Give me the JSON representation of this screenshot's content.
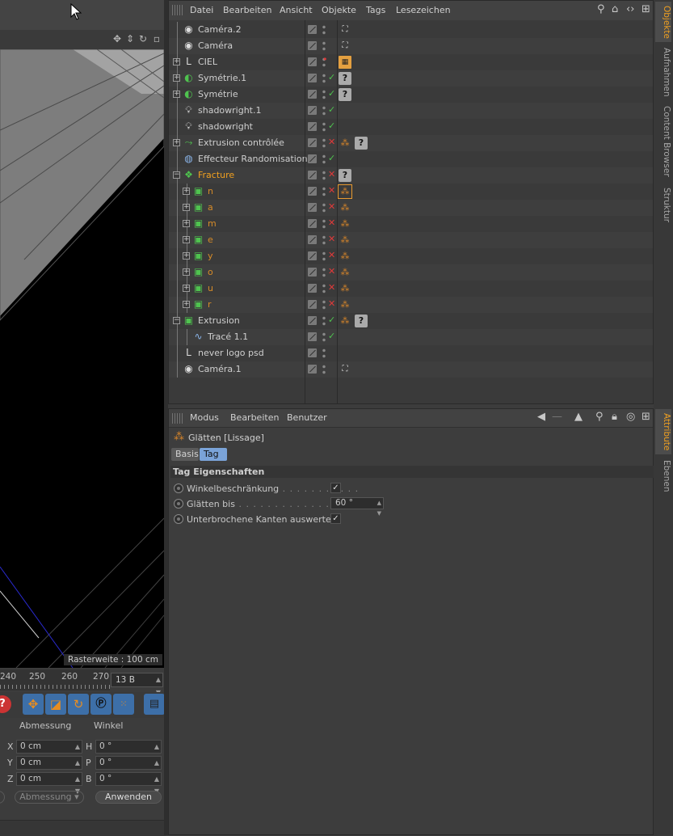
{
  "objects_manager": {
    "menu": [
      "Datei",
      "Bearbeiten",
      "Ansicht",
      "Objekte",
      "Tags",
      "Lesezeichen"
    ],
    "objects": [
      {
        "name": "Caméra.2",
        "icon": "camera-icon",
        "expand": false,
        "indent": 0,
        "enabled": "dot",
        "tags": [
          "camera-target-tag"
        ]
      },
      {
        "name": "Caméra",
        "icon": "camera-icon",
        "expand": false,
        "indent": 0,
        "enabled": "dot",
        "tags": [
          "camera-target-tag"
        ]
      },
      {
        "name": "CIEL",
        "icon": "sky-icon",
        "expand": true,
        "indent": 0,
        "enabled": "red-dot",
        "tags": [
          "film-tag"
        ]
      },
      {
        "name": "Symétrie.1",
        "icon": "symmetry-icon",
        "expand": true,
        "indent": 0,
        "enabled": "check",
        "tags": [
          "unknown-tag"
        ]
      },
      {
        "name": "Symétrie",
        "icon": "symmetry-icon",
        "expand": true,
        "indent": 0,
        "enabled": "check",
        "tags": [
          "unknown-tag"
        ]
      },
      {
        "name": "shadowright.1",
        "icon": "light-icon",
        "expand": false,
        "indent": 0,
        "enabled": "check",
        "tags": []
      },
      {
        "name": "shadowright",
        "icon": "light-icon",
        "expand": false,
        "indent": 0,
        "enabled": "check",
        "tags": []
      },
      {
        "name": "Extrusion contrôlée",
        "icon": "sweep-icon",
        "expand": true,
        "indent": 0,
        "enabled": "cross",
        "tags": [
          "phong-tag",
          "unknown-tag"
        ]
      },
      {
        "name": "Effecteur Randomisation",
        "icon": "effector-icon",
        "expand": false,
        "indent": 0,
        "enabled": "check",
        "tags": []
      },
      {
        "name": "Fracture",
        "icon": "fracture-icon",
        "expand": true,
        "indent": 0,
        "enabled": "cross",
        "tags": [
          "unknown-tag"
        ],
        "highlight": true
      },
      {
        "name": "n",
        "icon": "extrude-icon",
        "expand": true,
        "indent": 1,
        "enabled": "cross",
        "tags": [
          "phong-tag-selected"
        ],
        "orange": true
      },
      {
        "name": "a",
        "icon": "extrude-icon",
        "expand": true,
        "indent": 1,
        "enabled": "cross",
        "tags": [
          "phong-tag"
        ],
        "orange": true
      },
      {
        "name": "m",
        "icon": "extrude-icon",
        "expand": true,
        "indent": 1,
        "enabled": "cross",
        "tags": [
          "phong-tag"
        ],
        "orange": true
      },
      {
        "name": "e",
        "icon": "extrude-icon",
        "expand": true,
        "indent": 1,
        "enabled": "cross",
        "tags": [
          "phong-tag"
        ],
        "orange": true
      },
      {
        "name": "y",
        "icon": "extrude-icon",
        "expand": true,
        "indent": 1,
        "enabled": "cross",
        "tags": [
          "phong-tag"
        ],
        "orange": true
      },
      {
        "name": "o",
        "icon": "extrude-icon",
        "expand": true,
        "indent": 1,
        "enabled": "cross",
        "tags": [
          "phong-tag"
        ],
        "orange": true
      },
      {
        "name": "u",
        "icon": "extrude-icon",
        "expand": true,
        "indent": 1,
        "enabled": "cross",
        "tags": [
          "phong-tag"
        ],
        "orange": true
      },
      {
        "name": "r",
        "icon": "extrude-icon",
        "expand": true,
        "indent": 1,
        "enabled": "cross",
        "tags": [
          "phong-tag"
        ],
        "orange": true
      },
      {
        "name": "Extrusion",
        "icon": "extrude-icon",
        "expand": "minus",
        "indent": 0,
        "enabled": "check",
        "tags": [
          "phong-tag",
          "unknown-tag"
        ]
      },
      {
        "name": "Tracé 1.1",
        "icon": "spline-icon",
        "expand": false,
        "indent": 1,
        "enabled": "check",
        "tags": []
      },
      {
        "name": "never logo psd",
        "icon": "sky-icon",
        "expand": false,
        "indent": 0,
        "enabled": "dot",
        "tags": []
      },
      {
        "name": "Caméra.1",
        "icon": "camera-icon",
        "expand": false,
        "indent": 0,
        "enabled": "dot",
        "tags": [
          "camera-target-tag"
        ]
      }
    ]
  },
  "side_tabs_top": [
    "Objekte",
    "Aufnahmen",
    "Content Browser",
    "Struktur"
  ],
  "side_tabs_bottom": [
    "Attribute",
    "Ebenen"
  ],
  "attributes": {
    "menu": [
      "Modus",
      "Bearbeiten",
      "Benutzer"
    ],
    "title": "Glätten [Lissage]",
    "tabs": [
      "Basis",
      "Tag"
    ],
    "active_tab": "Tag",
    "section": "Tag Eigenschaften",
    "props": {
      "angle_limit_label": "Winkelbeschränkung",
      "angle_limit_checked": "✓",
      "smooth_to_label": "Glätten bis",
      "smooth_to_value": "60 °",
      "broken_edges_label": "Unterbrochene Kanten auswerten",
      "broken_edges_checked": "✓"
    }
  },
  "viewport": {
    "raster_label": "Rasterweite : 100 cm"
  },
  "timeline": {
    "ticks": [
      "240",
      "250",
      "260",
      "270"
    ],
    "frame_field": "13 B"
  },
  "coords": {
    "header_size": "Abmessung",
    "header_angle": "Winkel",
    "rows": [
      {
        "axis": "X",
        "pos": "0 cm",
        "rot_label": "H",
        "rot": "0 °"
      },
      {
        "axis": "Y",
        "pos": "0 cm",
        "rot_label": "P",
        "rot": "0 °"
      },
      {
        "axis": "Z",
        "pos": "0 cm",
        "rot_label": "B",
        "rot": "0 °"
      }
    ],
    "size_dropdown": "Abmessung",
    "apply_button": "Anwenden"
  },
  "colors": {
    "accent": "#f0a020",
    "object_orange": "#d78c28",
    "check_green": "#4fc34f",
    "cross_red": "#e03a3a"
  }
}
